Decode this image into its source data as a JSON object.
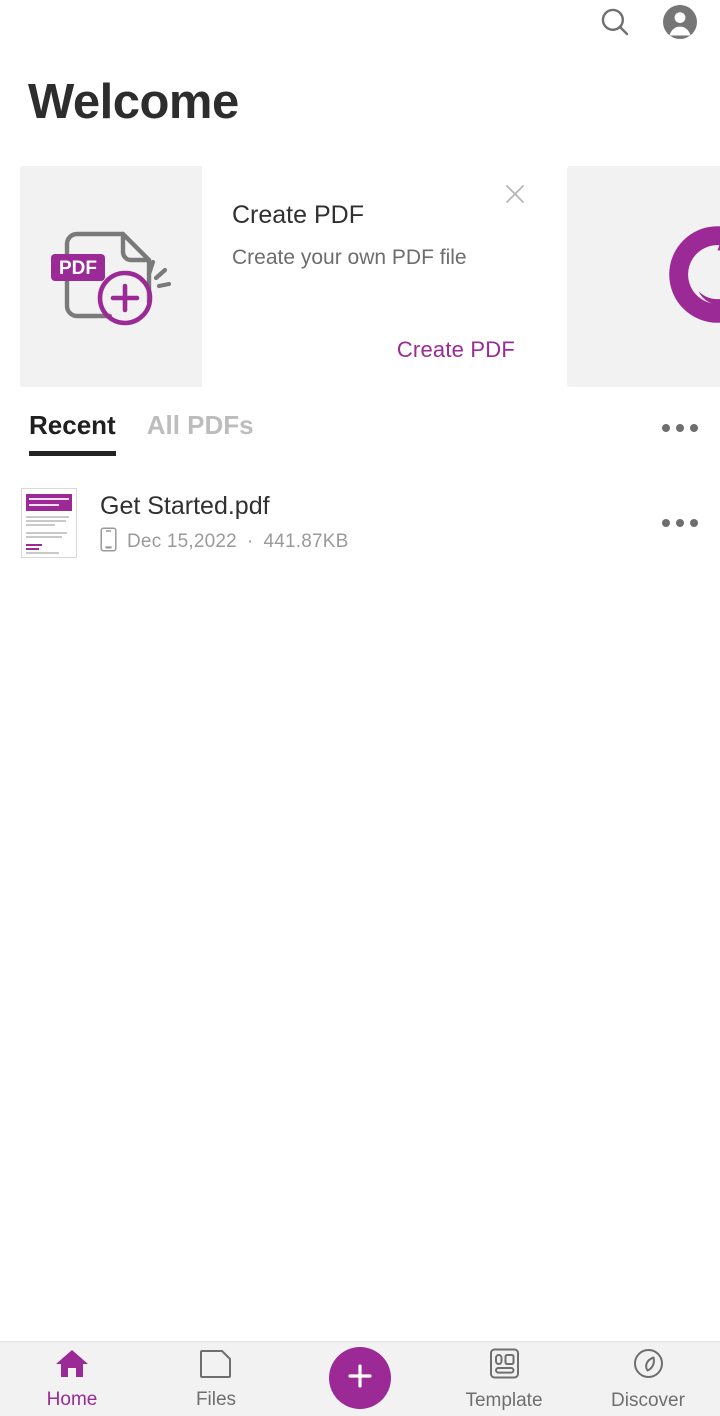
{
  "app": {
    "accent_color": "#9b2a96",
    "title": "Welcome"
  },
  "topbar": {
    "search_icon": "search-icon",
    "avatar_icon": "account-avatar-icon"
  },
  "banner": {
    "cards": [
      {
        "illustration": "pdf-add-document-icon",
        "badge_text": "PDF",
        "title": "Create PDF",
        "subtitle": "Create your own PDF file",
        "cta_label": "Create PDF",
        "close_icon": "close-icon"
      },
      {
        "illustration": "foxit-logo-icon"
      }
    ]
  },
  "tabs": {
    "items": [
      {
        "label": "Recent",
        "active": true
      },
      {
        "label": "All PDFs",
        "active": false
      }
    ],
    "overflow_icon": "more-options-icon"
  },
  "file_list": {
    "items": [
      {
        "thumbnail": "pdf-page-thumbnail",
        "name": "Get Started.pdf",
        "location_icon": "device-phone-icon",
        "date": "Dec 15,2022",
        "separator": "·",
        "size": "441.87KB",
        "overflow_icon": "more-options-icon"
      }
    ]
  },
  "bottom_nav": {
    "items": [
      {
        "label": "Home",
        "icon": "home-icon",
        "active": true
      },
      {
        "label": "Files",
        "icon": "folder-icon",
        "active": false
      },
      {
        "label": "Template",
        "icon": "template-icon",
        "active": false
      },
      {
        "label": "Discover",
        "icon": "compass-icon",
        "active": false
      }
    ],
    "fab": {
      "icon": "plus-icon",
      "label": "+"
    }
  }
}
